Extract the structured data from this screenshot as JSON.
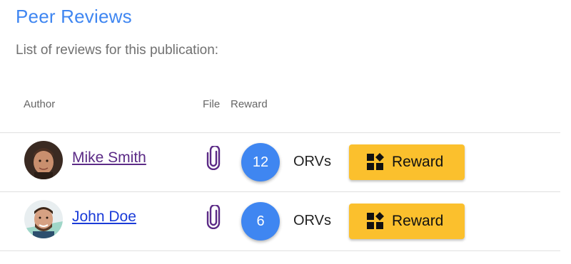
{
  "header": {
    "title": "Peer Reviews",
    "subtitle": "List of reviews for this publication:"
  },
  "table": {
    "columns": {
      "author": "Author",
      "file": "File",
      "reward": "Reward"
    },
    "rows": [
      {
        "author": "Mike Smith",
        "reward_amount": "12",
        "currency": "ORVs",
        "button_label": "Reward",
        "file_icon": "paperclip-icon",
        "button_icon": "blocks-icon"
      },
      {
        "author": "John Doe",
        "reward_amount": "6",
        "currency": "ORVs",
        "button_label": "Reward",
        "file_icon": "paperclip-icon",
        "button_icon": "blocks-icon"
      }
    ]
  },
  "colors": {
    "accent": "#3f86f1",
    "button": "#fbc02d",
    "visited_link": "#5b2a86",
    "link": "#1a3bd8"
  }
}
